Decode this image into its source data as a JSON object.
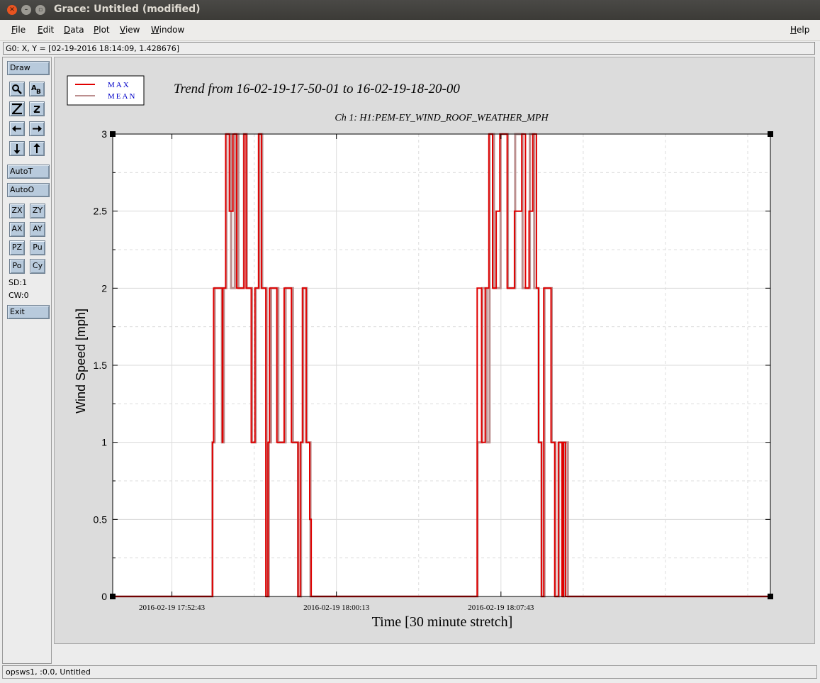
{
  "window": {
    "title": "Grace: Untitled (modified)"
  },
  "menu": {
    "file": "File",
    "edit": "Edit",
    "data": "Data",
    "plot": "Plot",
    "view": "View",
    "window": "Window",
    "help": "Help"
  },
  "locator": "G0: X, Y = [02-19-2016 18:14:09, 1.428676]",
  "toolbar": {
    "draw": "Draw",
    "autot": "AutoT",
    "autoo": "AutoO",
    "zx": "ZX",
    "zy": "ZY",
    "ax": "AX",
    "ay": "AY",
    "pz": "PZ",
    "pu": "Pu",
    "po": "Po",
    "cy": "Cy",
    "sd": "SD:1",
    "cw": "CW:0",
    "exit": "Exit",
    "icons": [
      "zoom-icon",
      "text-icon",
      "zoom-in-icon",
      "zoom-out-icon",
      "arrow-left-icon",
      "arrow-right-icon",
      "arrow-down-icon",
      "arrow-up-icon"
    ]
  },
  "status": "opsws1, :0.0, Untitled",
  "colors": {
    "max": "#e00000",
    "mean": "#bc8f8f",
    "legend_text": "#0000c8"
  },
  "chart_data": {
    "type": "line",
    "title": "Trend from 16-02-19-17-50-01 to 16-02-19-18-20-00",
    "subtitle": "Ch 1: H1:PEM-EY_WIND_ROOF_WEATHER_MPH",
    "xlabel": "Time [30 minute stretch]",
    "ylabel": "Wind Speed [mph]",
    "xlim": [
      "2016-02-19 17:50:01",
      "2016-02-19 18:20:00"
    ],
    "ylim": [
      0,
      3
    ],
    "yticks": [
      "0",
      "0.5",
      "1",
      "1.5",
      "2",
      "2.5",
      "3"
    ],
    "xticks": [
      {
        "t": "2016-02-19 17:52:43",
        "label": "2016-02-19 17:52:43"
      },
      {
        "t": "2016-02-19 18:00:13",
        "label": "2016-02-19 18:00:13"
      },
      {
        "t": "2016-02-19 18:07:43",
        "label": "2016-02-19 18:07:43"
      }
    ],
    "grid": true,
    "legend": "top-left",
    "series": [
      {
        "name": "MAX",
        "color": "#e00000",
        "points": [
          [
            "2016-02-19 17:50:01",
            0
          ],
          [
            "2016-02-19 17:54:33",
            0
          ],
          [
            "2016-02-19 17:54:34",
            1
          ],
          [
            "2016-02-19 17:54:37",
            2
          ],
          [
            "2016-02-19 17:55:00",
            2
          ],
          [
            "2016-02-19 17:55:01",
            1
          ],
          [
            "2016-02-19 17:55:02",
            2
          ],
          [
            "2016-02-19 17:55:10",
            3
          ],
          [
            "2016-02-19 17:55:20",
            2.5
          ],
          [
            "2016-02-19 17:55:30",
            3
          ],
          [
            "2016-02-19 17:55:40",
            2
          ],
          [
            "2016-02-19 17:56:00",
            3
          ],
          [
            "2016-02-19 17:56:06",
            2
          ],
          [
            "2016-02-19 17:56:20",
            1
          ],
          [
            "2016-02-19 17:56:30",
            2
          ],
          [
            "2016-02-19 17:56:40",
            3
          ],
          [
            "2016-02-19 17:56:48",
            2
          ],
          [
            "2016-02-19 17:57:00",
            0
          ],
          [
            "2016-02-19 17:57:06",
            1
          ],
          [
            "2016-02-19 17:57:10",
            2
          ],
          [
            "2016-02-19 17:57:30",
            1
          ],
          [
            "2016-02-19 17:57:50",
            2
          ],
          [
            "2016-02-19 17:58:10",
            1
          ],
          [
            "2016-02-19 17:58:28",
            0
          ],
          [
            "2016-02-19 17:58:34",
            1
          ],
          [
            "2016-02-19 17:58:40",
            2
          ],
          [
            "2016-02-19 17:58:50",
            1
          ],
          [
            "2016-02-19 17:59:00",
            0.5
          ],
          [
            "2016-02-19 17:59:04",
            0
          ],
          [
            "2016-02-19 18:06:37",
            0
          ],
          [
            "2016-02-19 18:06:38",
            2
          ],
          [
            "2016-02-19 18:06:50",
            1
          ],
          [
            "2016-02-19 18:07:00",
            2
          ],
          [
            "2016-02-19 18:07:10",
            3
          ],
          [
            "2016-02-19 18:07:20",
            2
          ],
          [
            "2016-02-19 18:07:30",
            2.5
          ],
          [
            "2016-02-19 18:07:40",
            3
          ],
          [
            "2016-02-19 18:08:00",
            2
          ],
          [
            "2016-02-19 18:08:20",
            2.5
          ],
          [
            "2016-02-19 18:08:40",
            3
          ],
          [
            "2016-02-19 18:08:50",
            2
          ],
          [
            "2016-02-19 18:09:00",
            2.5
          ],
          [
            "2016-02-19 18:09:10",
            3
          ],
          [
            "2016-02-19 18:09:20",
            2
          ],
          [
            "2016-02-19 18:09:26",
            1
          ],
          [
            "2016-02-19 18:09:34",
            0
          ],
          [
            "2016-02-19 18:09:40",
            2
          ],
          [
            "2016-02-19 18:10:00",
            1
          ],
          [
            "2016-02-19 18:10:10",
            0
          ],
          [
            "2016-02-19 18:10:20",
            1
          ],
          [
            "2016-02-19 18:10:30",
            0
          ],
          [
            "2016-02-19 18:10:34",
            1
          ],
          [
            "2016-02-19 18:10:40",
            0
          ],
          [
            "2016-02-19 18:10:46",
            0
          ],
          [
            "2016-02-19 18:20:00",
            0
          ]
        ]
      },
      {
        "name": "MEAN",
        "color": "#bc8f8f",
        "points": [
          [
            "2016-02-19 17:50:01",
            0
          ],
          [
            "2016-02-19 17:54:33",
            0
          ],
          [
            "2016-02-19 17:54:34",
            1
          ],
          [
            "2016-02-19 17:54:40",
            2
          ],
          [
            "2016-02-19 17:55:00",
            1
          ],
          [
            "2016-02-19 17:55:05",
            2
          ],
          [
            "2016-02-19 17:55:12",
            3
          ],
          [
            "2016-02-19 17:55:25",
            2
          ],
          [
            "2016-02-19 17:55:35",
            3
          ],
          [
            "2016-02-19 17:55:45",
            2
          ],
          [
            "2016-02-19 17:56:00",
            3
          ],
          [
            "2016-02-19 17:56:08",
            2
          ],
          [
            "2016-02-19 17:56:22",
            1
          ],
          [
            "2016-02-19 17:56:32",
            2
          ],
          [
            "2016-02-19 17:56:42",
            3
          ],
          [
            "2016-02-19 17:56:50",
            2
          ],
          [
            "2016-02-19 17:57:02",
            0
          ],
          [
            "2016-02-19 17:57:08",
            1
          ],
          [
            "2016-02-19 17:57:14",
            2
          ],
          [
            "2016-02-19 17:57:34",
            1
          ],
          [
            "2016-02-19 17:57:54",
            2
          ],
          [
            "2016-02-19 17:58:14",
            1
          ],
          [
            "2016-02-19 17:58:28",
            0
          ],
          [
            "2016-02-19 17:58:36",
            1
          ],
          [
            "2016-02-19 17:58:42",
            2
          ],
          [
            "2016-02-19 17:58:52",
            1
          ],
          [
            "2016-02-19 17:59:02",
            0
          ],
          [
            "2016-02-19 18:06:37",
            0
          ],
          [
            "2016-02-19 18:06:39",
            1
          ],
          [
            "2016-02-19 18:06:52",
            2
          ],
          [
            "2016-02-19 18:07:04",
            1
          ],
          [
            "2016-02-19 18:07:12",
            3
          ],
          [
            "2016-02-19 18:07:24",
            2
          ],
          [
            "2016-02-19 18:07:42",
            3
          ],
          [
            "2016-02-19 18:08:02",
            2
          ],
          [
            "2016-02-19 18:08:22",
            3
          ],
          [
            "2016-02-19 18:08:42",
            2
          ],
          [
            "2016-02-19 18:09:02",
            3
          ],
          [
            "2016-02-19 18:09:14",
            2
          ],
          [
            "2016-02-19 18:09:26",
            1
          ],
          [
            "2016-02-19 18:09:34",
            0
          ],
          [
            "2016-02-19 18:09:42",
            2
          ],
          [
            "2016-02-19 18:10:02",
            1
          ],
          [
            "2016-02-19 18:10:12",
            0
          ],
          [
            "2016-02-19 18:10:22",
            1
          ],
          [
            "2016-02-19 18:10:32",
            0
          ],
          [
            "2016-02-19 18:10:36",
            1
          ],
          [
            "2016-02-19 18:10:46",
            0
          ],
          [
            "2016-02-19 18:20:00",
            0
          ]
        ]
      }
    ]
  }
}
